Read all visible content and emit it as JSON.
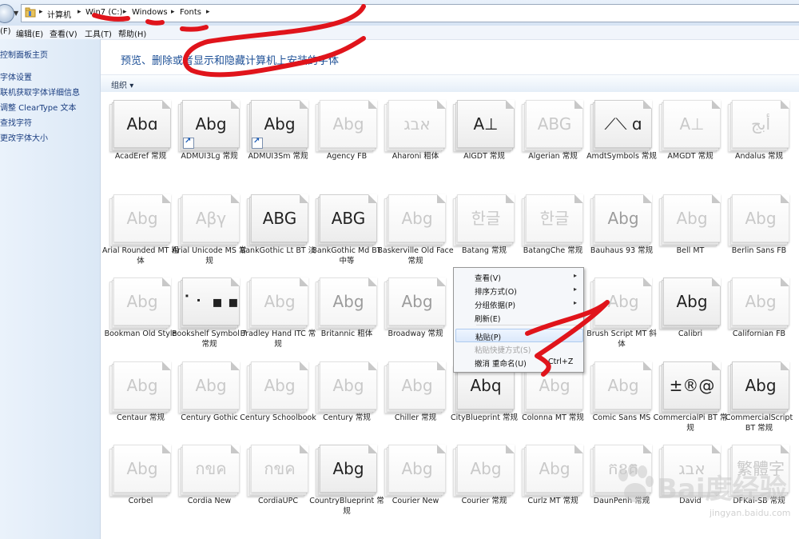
{
  "address": {
    "crumbs": [
      "计算机",
      "Win7 (C:)",
      "Windows",
      "Fonts"
    ]
  },
  "menu": {
    "items": [
      "(F)",
      "编辑(E)",
      "查看(V)",
      "工具(T)",
      "帮助(H)"
    ]
  },
  "left_panel": {
    "links": [
      "控制面板主页",
      "字体设置",
      "联机获取字体详细信息",
      "调整 ClearType 文本",
      "查找字符",
      "更改字体大小"
    ]
  },
  "header": {
    "title": "预览、删除或者显示和隐藏计算机上安装的字体"
  },
  "toolbar": {
    "organize": "组织",
    "organize_arrow": "▾"
  },
  "fonts": [
    {
      "name": "AcadEref 常规",
      "sample": "Abɑ",
      "style": "normal"
    },
    {
      "name": "ADMUI3Lg 常规",
      "sample": "Abg",
      "style": "shortcut"
    },
    {
      "name": "ADMUI3Sm 常规",
      "sample": "Abg",
      "style": "shortcut"
    },
    {
      "name": "Agency FB",
      "sample": "Abg",
      "style": "faint"
    },
    {
      "name": "Aharoni 粗体",
      "sample": "אבג",
      "style": "faint"
    },
    {
      "name": "AIGDT 常规",
      "sample": "A⊥",
      "style": "normal"
    },
    {
      "name": "Algerian 常规",
      "sample": "ABG",
      "style": "faint"
    },
    {
      "name": "AmdtSymbols 常规",
      "sample": "⟋⟍ ɑ",
      "style": "normal"
    },
    {
      "name": "AMGDT 常规",
      "sample": "A⊥",
      "style": "faint"
    },
    {
      "name": "Andalus 常规",
      "sample": "أبج",
      "style": "faint"
    },
    {
      "name": "Arial Rounded MT 粗体",
      "sample": "Abg",
      "style": "faint"
    },
    {
      "name": "Arial Unicode MS 常规",
      "sample": "Αβγ",
      "style": "faint"
    },
    {
      "name": "BankGothic Lt BT 淡",
      "sample": "ABG",
      "style": "normal"
    },
    {
      "name": "BankGothic Md BT 中等",
      "sample": "ABG",
      "style": "normal"
    },
    {
      "name": "Baskerville Old Face 常规",
      "sample": "Abg",
      "style": "faint"
    },
    {
      "name": "Batang 常规",
      "sample": "한글",
      "style": "faint"
    },
    {
      "name": "BatangChe 常规",
      "sample": "한글",
      "style": "faint"
    },
    {
      "name": "Bauhaus 93 常规",
      "sample": "Abg",
      "style": "mid"
    },
    {
      "name": "Bell MT",
      "sample": "Abg",
      "style": "faint"
    },
    {
      "name": "Berlin Sans FB",
      "sample": "Abg",
      "style": "faint"
    },
    {
      "name": "Bookman Old Style",
      "sample": "Abg",
      "style": "faint"
    },
    {
      "name": "Bookshelf Symbol 7 常规",
      "sample": "⠁⠂ ▪ ▪",
      "style": "normal"
    },
    {
      "name": "Bradley Hand ITC 常规",
      "sample": "Abg",
      "style": "faint"
    },
    {
      "name": "Britannic 粗体",
      "sample": "Abg",
      "style": "mid"
    },
    {
      "name": "Broadway 常规",
      "sample": "Abg",
      "style": "mid"
    },
    {
      "name": "",
      "sample": "",
      "style": "hidden"
    },
    {
      "name": "",
      "sample": "",
      "style": "hidden"
    },
    {
      "name": "Brush Script MT 斜体",
      "sample": "Abg",
      "style": "faint"
    },
    {
      "name": "Calibri",
      "sample": "Abg",
      "style": "normal"
    },
    {
      "name": "Californian FB",
      "sample": "Abg",
      "style": "faint"
    },
    {
      "name": "Centaur 常规",
      "sample": "Abg",
      "style": "faint"
    },
    {
      "name": "Century Gothic",
      "sample": "Abg",
      "style": "faint"
    },
    {
      "name": "Century Schoolbook",
      "sample": "Abg",
      "style": "faint"
    },
    {
      "name": "Century 常规",
      "sample": "Abg",
      "style": "faint"
    },
    {
      "name": "Chiller 常规",
      "sample": "Abg",
      "style": "faint"
    },
    {
      "name": "CityBlueprint 常规",
      "sample": "Abq",
      "style": "normal"
    },
    {
      "name": "Colonna MT 常规",
      "sample": "Abg",
      "style": "faint"
    },
    {
      "name": "Comic Sans MS",
      "sample": "Abg",
      "style": "faint"
    },
    {
      "name": "CommercialPi BT 常规",
      "sample": "±®@",
      "style": "normal"
    },
    {
      "name": "CommercialScript BT 常规",
      "sample": "Abg",
      "style": "normal"
    },
    {
      "name": "Corbel",
      "sample": "Abg",
      "style": "faint"
    },
    {
      "name": "Cordia New",
      "sample": "กขค",
      "style": "faint"
    },
    {
      "name": "CordiaUPC",
      "sample": "กขค",
      "style": "faint"
    },
    {
      "name": "CountryBlueprint 常规",
      "sample": "Abg",
      "style": "normal"
    },
    {
      "name": "Courier New",
      "sample": "Abg",
      "style": "faint"
    },
    {
      "name": "Courier 常规",
      "sample": "Abg",
      "style": "faint"
    },
    {
      "name": "Curlz MT 常规",
      "sample": "Abg",
      "style": "faint"
    },
    {
      "name": "DaunPenh 常规",
      "sample": "កខគ",
      "style": "faint"
    },
    {
      "name": "David",
      "sample": "אבג",
      "style": "faint"
    },
    {
      "name": "DFKai-SB 常规",
      "sample": "繁體字",
      "style": "faint"
    }
  ],
  "context_menu": {
    "items": [
      {
        "label": "查看(V)",
        "arrow": "▸",
        "shortcut": "",
        "disabled": false,
        "highlighted": false
      },
      {
        "label": "排序方式(O)",
        "arrow": "▸",
        "shortcut": "",
        "disabled": false,
        "highlighted": false
      },
      {
        "label": "分组依据(P)",
        "arrow": "▸",
        "shortcut": "",
        "disabled": false,
        "highlighted": false
      },
      {
        "label": "刷新(E)",
        "arrow": "",
        "shortcut": "",
        "disabled": false,
        "highlighted": false
      },
      {
        "label": "粘贴(P)",
        "arrow": "",
        "shortcut": "",
        "disabled": false,
        "highlighted": true
      },
      {
        "label": "粘贴快捷方式(S)",
        "arrow": "",
        "shortcut": "",
        "disabled": true,
        "highlighted": false
      },
      {
        "label": "撤消 重命名(U)",
        "arrow": "",
        "shortcut": "Ctrl+Z",
        "disabled": false,
        "highlighted": false
      }
    ]
  },
  "watermark": {
    "text": "Bai度经验",
    "url": "jingyan.baidu.com"
  },
  "colors": {
    "annotation": "#e0141b",
    "link": "#1b3e80",
    "title": "#1c4f96"
  }
}
